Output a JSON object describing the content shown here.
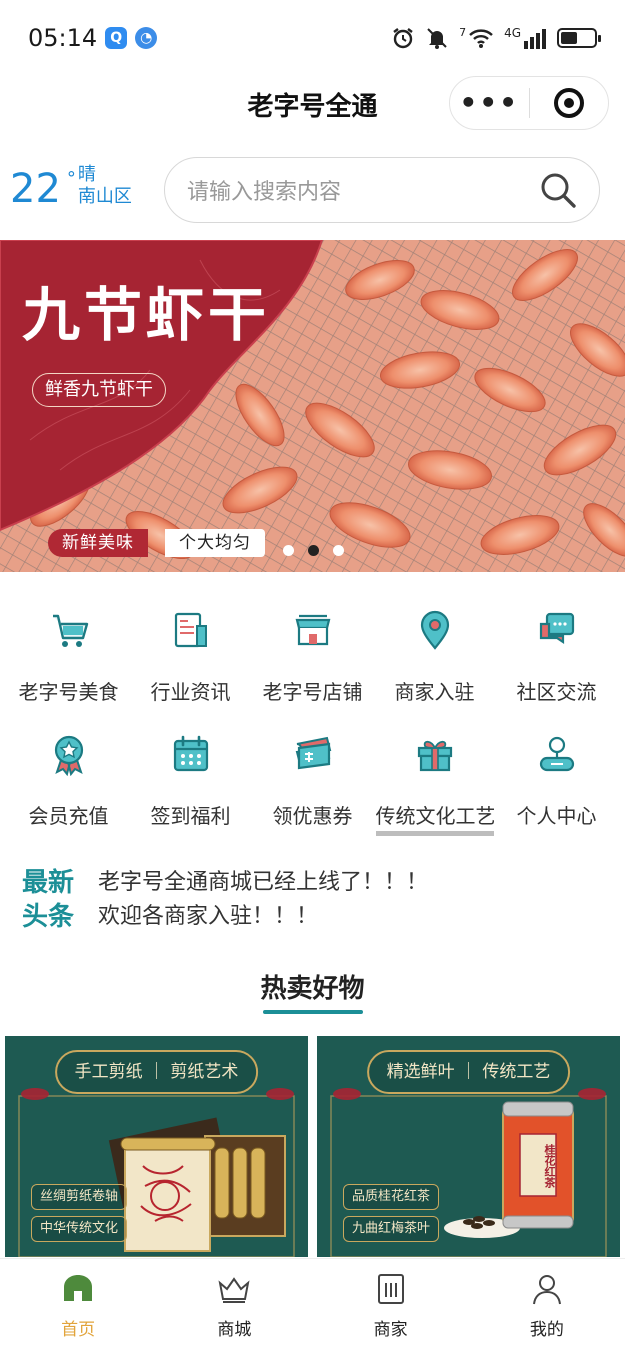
{
  "status_bar": {
    "time": "05:14",
    "network": "4G",
    "signal_label": "7",
    "battery_level": 0.5
  },
  "nav": {
    "title": "老字号全通",
    "more_icon": "more-dots-icon",
    "close_icon": "target-icon"
  },
  "weather": {
    "temperature": "22",
    "degree": "°",
    "condition": "晴",
    "district": "南山区"
  },
  "search": {
    "placeholder": "请输入搜索内容"
  },
  "banner": {
    "title": "九节虾干",
    "subtitle": "鲜香九节虾干",
    "tag_left": "新鲜美味",
    "tag_right": "个大均匀",
    "slide_count": 3,
    "active_slide": 2
  },
  "menu": {
    "items": [
      {
        "label": "老字号美食",
        "icon": "cart-icon"
      },
      {
        "label": "行业资讯",
        "icon": "document-icon"
      },
      {
        "label": "老字号店铺",
        "icon": "store-icon"
      },
      {
        "label": "商家入驻",
        "icon": "location-pin-icon"
      },
      {
        "label": "社区交流",
        "icon": "chat-icon"
      },
      {
        "label": "会员充值",
        "icon": "medal-icon"
      },
      {
        "label": "签到福利",
        "icon": "calendar-icon"
      },
      {
        "label": "领优惠券",
        "icon": "coupon-icon"
      },
      {
        "label": "传统文化工艺",
        "icon": "gift-icon"
      },
      {
        "label": "个人中心",
        "icon": "user-icon"
      }
    ]
  },
  "news": {
    "tag_line1": "最新",
    "tag_line2": "头条",
    "items": [
      "老字号全通商城已经上线了！！！",
      "欢迎各商家入驻！！！"
    ]
  },
  "section": {
    "title": "热卖好物"
  },
  "products": [
    {
      "ribbon_left": "手工剪纸",
      "ribbon_right": "剪纸艺术",
      "pill1": "丝绸剪纸卷轴",
      "pill2": "中华传统文化"
    },
    {
      "ribbon_left": "精选鲜叶",
      "ribbon_right": "传统工艺",
      "pill1": "品质桂花红茶",
      "pill2": "九曲红梅茶叶",
      "can_label": "桂花红茶"
    }
  ],
  "tabbar": {
    "items": [
      {
        "label": "首页",
        "icon": "home-icon"
      },
      {
        "label": "商城",
        "icon": "crown-icon"
      },
      {
        "label": "商家",
        "icon": "shop-book-icon"
      },
      {
        "label": "我的",
        "icon": "profile-icon"
      }
    ],
    "active_index": 0,
    "active_color": "#e2a43b"
  },
  "colors": {
    "accent": "#1c8f97",
    "weather_blue": "#1f89d3",
    "banner_red": "#b02834"
  }
}
